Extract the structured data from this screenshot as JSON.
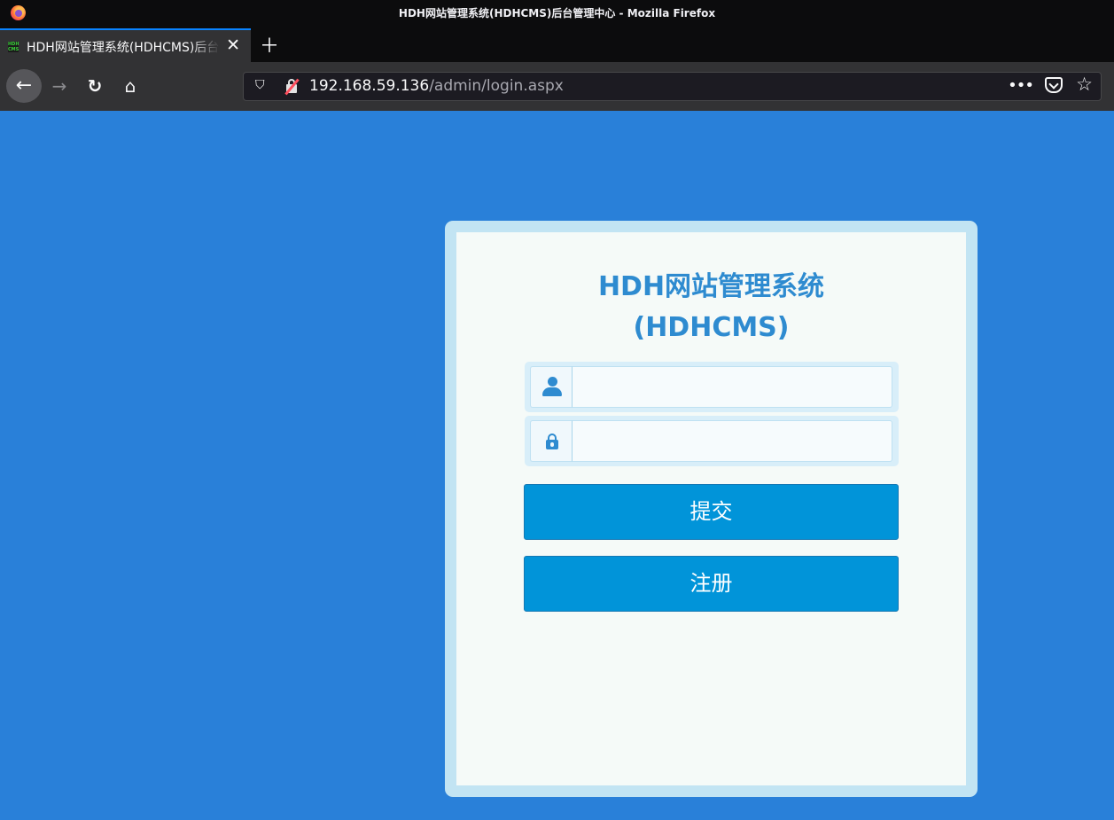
{
  "window": {
    "title": "HDH网站管理系统(HDHCMS)后台管理中心 - Mozilla Firefox"
  },
  "tabs": [
    {
      "label": "HDH网站管理系统(HDHCMS)后台管理中心",
      "favicon_text": "HDH CMS",
      "active": true
    }
  ],
  "toolbar": {
    "icons": [
      "back-arrow-icon",
      "forward-arrow-icon",
      "reload-icon",
      "home-icon",
      "tracking-shield-icon",
      "insecure-lock-icon",
      "page-actions-menu-icon",
      "pocket-icon",
      "bookmark-star-icon"
    ]
  },
  "urlbar": {
    "host": "192.168.59.136",
    "path": "/admin/login.aspx"
  },
  "login": {
    "title_line1": "HDH网站管理系统",
    "title_line2": "(HDHCMS)",
    "username_value": "",
    "password_value": "",
    "submit_label": "提交",
    "register_label": "注册"
  },
  "colors": {
    "page_background": "#2980d9",
    "card_border": "#c2e4f3",
    "card_background": "#f5faf8",
    "title": "#2e8bd0",
    "button": "#0194d9",
    "tab_accent": "#0a84ff"
  }
}
